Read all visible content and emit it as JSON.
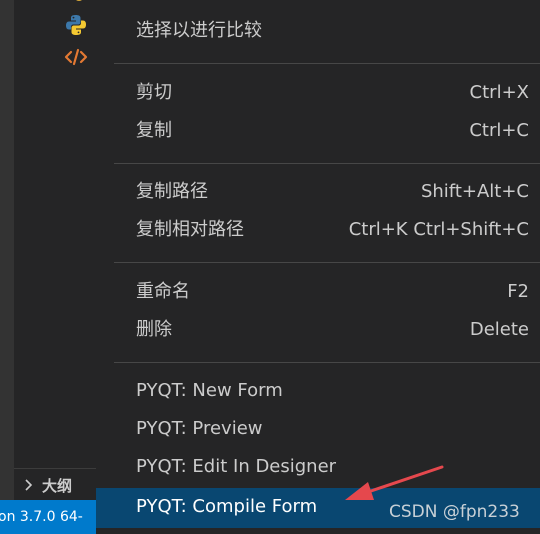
{
  "menu": {
    "items": [
      {
        "label": "选择以进行比较",
        "shortcut": ""
      },
      {
        "label": "剪切",
        "shortcut": "Ctrl+X"
      },
      {
        "label": "复制",
        "shortcut": "Ctrl+C"
      },
      {
        "label": "复制路径",
        "shortcut": "Shift+Alt+C"
      },
      {
        "label": "复制相对路径",
        "shortcut": "Ctrl+K Ctrl+Shift+C"
      },
      {
        "label": "重命名",
        "shortcut": "F2"
      },
      {
        "label": "删除",
        "shortcut": "Delete"
      },
      {
        "label": "PYQT: New Form",
        "shortcut": ""
      },
      {
        "label": "PYQT: Preview",
        "shortcut": ""
      },
      {
        "label": "PYQT: Edit In Designer",
        "shortcut": ""
      },
      {
        "label": "PYQT: Compile Form",
        "shortcut": ""
      }
    ],
    "highlighted_item": "PYQT: Compile Form"
  },
  "sidebar": {
    "outline_label": "大纲",
    "file_icons": [
      "python-file-icon",
      "code-file-icon"
    ]
  },
  "statusbar": {
    "python_interpreter": "on 3.7.0 64-"
  },
  "watermark": "CSDN @fpn233",
  "colors": {
    "menu_bg": "#252526",
    "highlight": "#094771",
    "status_blue": "#007acc",
    "arrow_red": "#e5484d",
    "code_icon_orange": "#e37933"
  }
}
